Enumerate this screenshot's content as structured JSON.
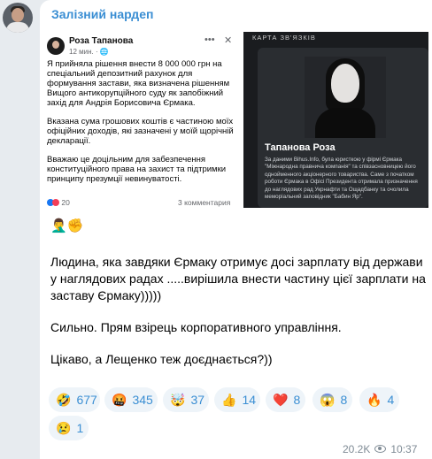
{
  "channel": {
    "name": "Залізний нардеп"
  },
  "screenshot": {
    "post": {
      "author": "Роза Тапанова",
      "time": "12 мин. · ",
      "paragraphs": [
        "Я прийняла рішення внести 8 000 000 грн на спеціальний депозитний рахунок для формування застави, яка визначена рішенням Вищого антикорупційного суду як запобіжний захід для Андрія Борисовича Єрмака.",
        "Вказана сума грошових коштів є частиною моїх офіційних доходів, які зазначені у моїй щорічній декларації.",
        "Вважаю це доцільним для забезпечення конституційного права на захист та підтримки принципу презумції невинуватості."
      ],
      "reactions_count": "20",
      "comments": "3 комментария"
    },
    "card": {
      "header": "КАРТА ЗВ'ЯЗКІВ",
      "name": "Тапанова Роза",
      "text": "За даними Bihus.Info, була юристкою у фірмі Єрмака \"Міжнародна правнича компанія\" та співзасновницею його однойменного акціонерного товариства. Саме з початком роботи Єрмака в Офісі Президента отримала призначення до наглядових рад Укрнафти та Ощадбанку та очолила меморіальний заповідник \"Бабин Яр\"."
    }
  },
  "message": {
    "emojis": "🤦‍♂️✊",
    "paragraphs": [
      "Людина, яка завдяки Єрмаку отримує досі зарплату від держави у наглядових радах .....вирішила внести частину цієї зарплати на заставу Єрмаку)))))",
      "Сильно. Прям взірець корпоративного управління.",
      "Цікаво, а Лещенко теж доєднається?))"
    ]
  },
  "reactions": [
    {
      "emoji": "🤣",
      "count": "677"
    },
    {
      "emoji": "🤬",
      "count": "345"
    },
    {
      "emoji": "🤯",
      "count": "37"
    },
    {
      "emoji": "👍",
      "count": "14"
    },
    {
      "emoji": "❤️",
      "count": "8"
    },
    {
      "emoji": "😱",
      "count": "8"
    },
    {
      "emoji": "🔥",
      "count": "4"
    },
    {
      "emoji": "😢",
      "count": "1"
    }
  ],
  "meta": {
    "views": "20.2K",
    "time": "10:37"
  },
  "colors": {
    "accent": "#3a8ed3",
    "reaction_bg": "#eef4f9"
  }
}
